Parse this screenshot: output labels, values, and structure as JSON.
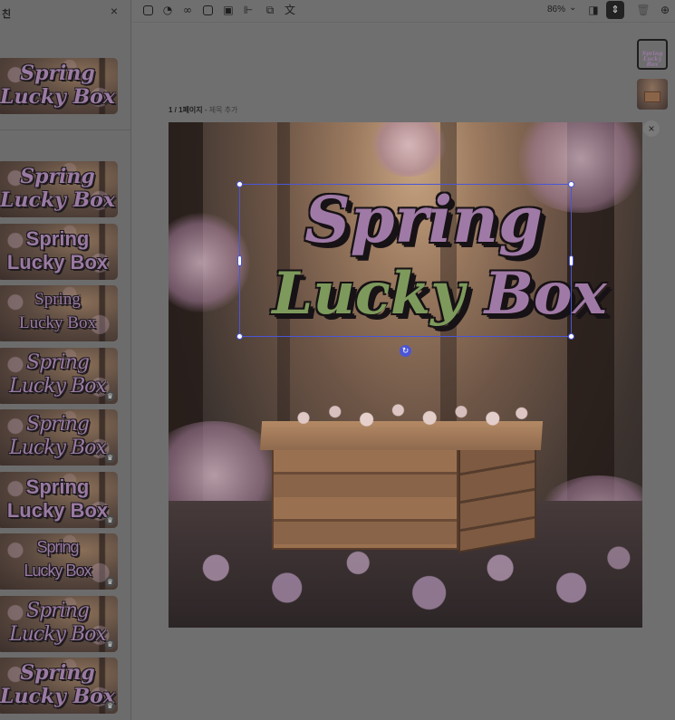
{
  "left_panel": {
    "title": "친",
    "close_icon": "×",
    "thumbnails": [
      {
        "line1": "Spring",
        "line2": "Lucky Box",
        "style": "serif",
        "premium": false
      },
      {
        "line1": "Spring",
        "line2": "Lucky Box",
        "style": "serif",
        "premium": false
      },
      {
        "line1": "Spring",
        "line2": "Lucky Box",
        "style": "sans",
        "premium": false
      },
      {
        "line1": "Spring",
        "line2": "Lucky Box",
        "style": "thin",
        "premium": false
      },
      {
        "line1": "Spring",
        "line2": "Lucky Box",
        "style": "script",
        "premium": true
      },
      {
        "line1": "Spring",
        "line2": "Lucky Box",
        "style": "script",
        "premium": true
      },
      {
        "line1": "Spring",
        "line2": "Lucky Box",
        "style": "sans",
        "premium": true
      },
      {
        "line1": "Spring",
        "line2": "Lucky Box",
        "style": "cond",
        "premium": true
      },
      {
        "line1": "Spring",
        "line2": "Lucky Box",
        "style": "script",
        "premium": true
      },
      {
        "line1": "Spring",
        "line2": "Lucky Box",
        "style": "serif",
        "premium": true
      }
    ]
  },
  "toolbar": {
    "icons": [
      "frame-tool-icon",
      "swatch-icon",
      "link-icon",
      "square-icon",
      "frame-icon",
      "align-left-icon",
      "copy-icon",
      "translate-icon"
    ],
    "zoom": "86%",
    "zoom_caret": "⌄",
    "right_icons": [
      "layers-icon",
      "spacing-icon",
      "trash-icon",
      "add-page-icon"
    ]
  },
  "page": {
    "number": "1 / 1페이지",
    "separator": " - ",
    "title_placeholder": "제목 추가",
    "headline_line1": "Spring",
    "headline_line2_word1": "Lucky",
    "headline_line2_word2": "Box",
    "close": "×",
    "rotate": "↻"
  },
  "colors": {
    "headline_purple": "#a07aa6",
    "headline_green": "#7d9a5c",
    "selection": "#4a56d6"
  },
  "page_thumbs": [
    {
      "label": "Spring Lucky Box",
      "active": true
    },
    {
      "label": "",
      "active": false
    }
  ]
}
